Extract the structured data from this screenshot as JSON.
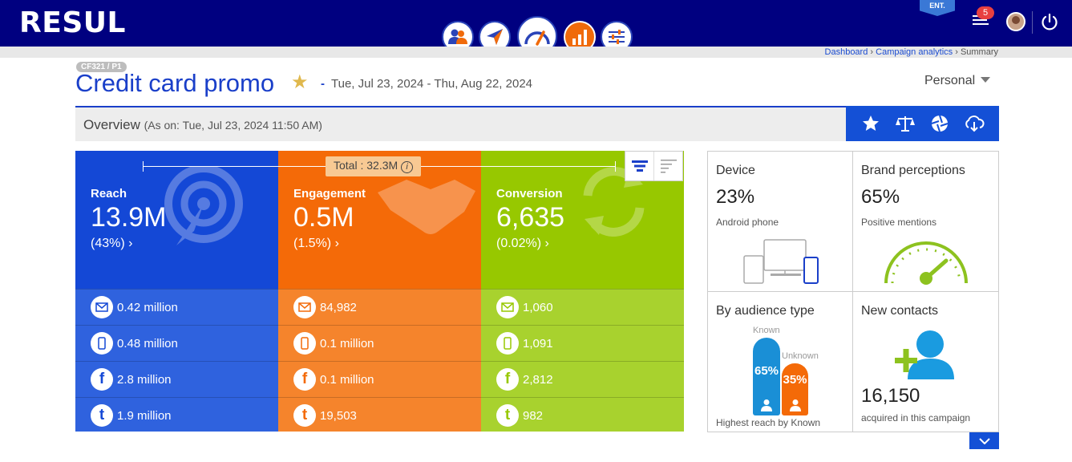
{
  "header": {
    "logo": "RESUL",
    "ent_badge": "ENT.",
    "notifications_count": "5",
    "nav": [
      "audience-icon",
      "campaign-send-icon",
      "analytics-gauge-icon",
      "bar-chart-icon",
      "settings-sliders-icon"
    ]
  },
  "breadcrumb": {
    "dashboard": "Dashboard",
    "campaign_analytics": "Campaign analytics",
    "current": "Summary",
    "sep": "›"
  },
  "campaign": {
    "tag": "CF321 / P1",
    "title": "Credit card promo",
    "date_range": "Tue, Jul 23, 2024 - Thu, Aug 22, 2024",
    "dash": "-",
    "view_select": "Personal"
  },
  "overview": {
    "title": "Overview",
    "as_on": "(As on: Tue, Jul 23, 2024 11:50 AM)"
  },
  "total": {
    "label": "Total : 32.3M",
    "info": "i"
  },
  "panels": {
    "reach": {
      "label": "Reach",
      "value": "13.9M",
      "pct": "(43%) ›",
      "color": "#1448d6",
      "rows": [
        "0.42 million",
        "0.48 million",
        "2.8 million",
        "1.9 million"
      ]
    },
    "engagement": {
      "label": "Engagement",
      "value": "0.5M",
      "pct": "(1.5%) ›",
      "color": "#f46a08",
      "rows": [
        "84,982",
        "0.1 million",
        "0.1 million",
        "19,503"
      ]
    },
    "conversion": {
      "label": "Conversion",
      "value": "6,635",
      "pct": "(0.02%) ›",
      "color": "#97c800",
      "rows": [
        "1,060",
        "1,091",
        "2,812",
        "982"
      ]
    }
  },
  "row_icons": [
    "email-icon",
    "mobile-icon",
    "facebook-icon",
    "twitter-icon"
  ],
  "cards": {
    "device": {
      "title": "Device",
      "value": "23%",
      "sub": "Android phone"
    },
    "brand": {
      "title": "Brand perceptions",
      "value": "65%",
      "sub": "Positive mentions"
    },
    "audience": {
      "title": "By audience type",
      "known_label": "Known",
      "unknown_label": "Unknown",
      "known_value": "65%",
      "unknown_value": "35%",
      "sub": "Highest reach by Known",
      "known_fraction": 0.65,
      "unknown_fraction": 0.35
    },
    "contacts": {
      "title": "New contacts",
      "value": "16,150",
      "sub": "acquired in this campaign"
    }
  }
}
